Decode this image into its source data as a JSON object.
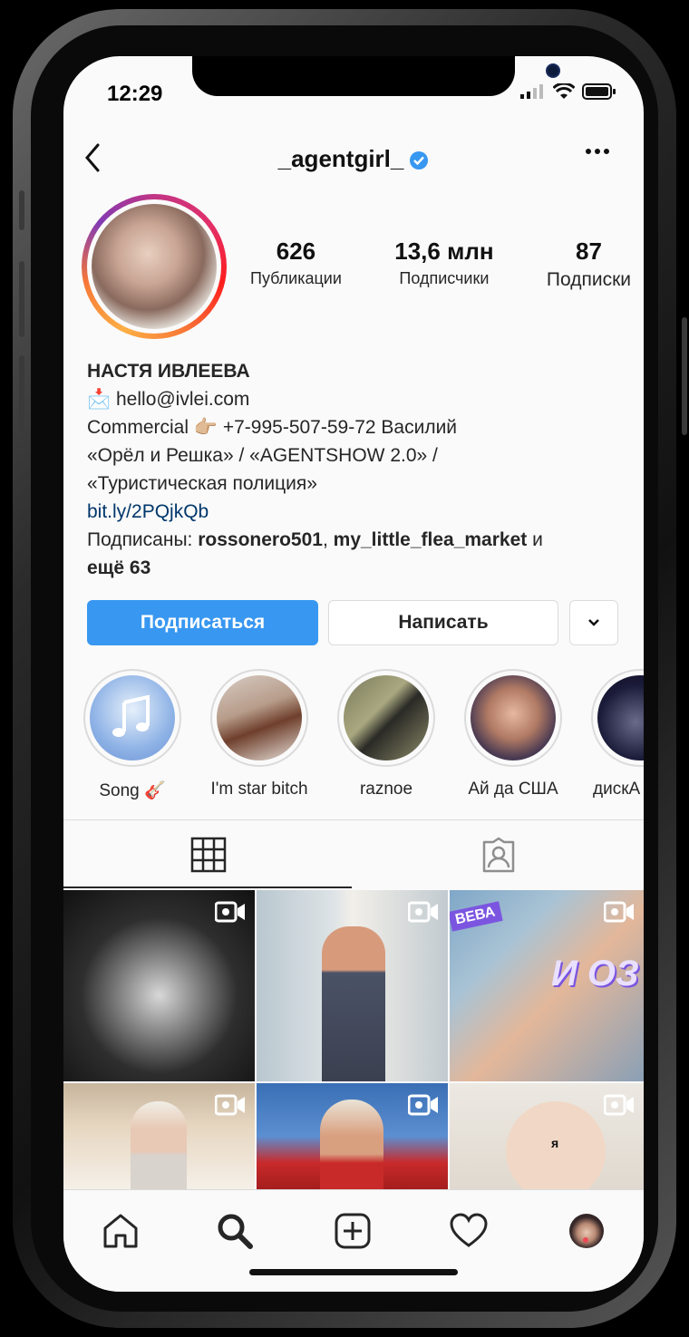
{
  "status": {
    "time": "12:29"
  },
  "header": {
    "username": "_agentgirl_"
  },
  "profile": {
    "stats": [
      {
        "value": "626",
        "label": "Публикации"
      },
      {
        "value": "13,6 млн",
        "label": "Подписчики"
      },
      {
        "value": "87",
        "label": "Подписки"
      }
    ]
  },
  "bio": {
    "name": "НАСТЯ ИВЛЕЕВА",
    "email_emoji": "📩",
    "email": "hello@ivlei.com",
    "commercial": "Commercial",
    "commercial_emoji": "👉🏼",
    "phone": "+7-995-507-59-72 Василий",
    "line3": "«Орёл и Решка» / «AGENTSHOW 2.0» /",
    "line4": "«Туристическая полиция»",
    "link": "bit.ly/2PQjkQb",
    "followed_prefix": "Подписаны:",
    "followed_user1": "rossonero501",
    "followed_sep": ",",
    "followed_user2": "my_little_flea_market",
    "followed_and": "и",
    "followed_more": "ещё 63"
  },
  "buttons": {
    "follow": "Подписаться",
    "message": "Написать"
  },
  "highlights": [
    {
      "label": "Song 🎸"
    },
    {
      "label": "I'm star bitch"
    },
    {
      "label": "raznoe"
    },
    {
      "label": "Ай да США"
    },
    {
      "label": "дискА"
    }
  ],
  "grid": {
    "thumb_texts": [
      "ВЕВА",
      "И ОЗ",
      "я"
    ]
  },
  "colors": {
    "accent": "#3897f0",
    "verified": "#3897f0",
    "link": "#00376b",
    "notification": "#ed4956"
  },
  "icons": [
    "back-icon",
    "verified-icon",
    "more-icon",
    "grid-icon",
    "tagged-icon",
    "video-icon",
    "home-icon",
    "search-icon",
    "add-icon",
    "heart-icon"
  ]
}
